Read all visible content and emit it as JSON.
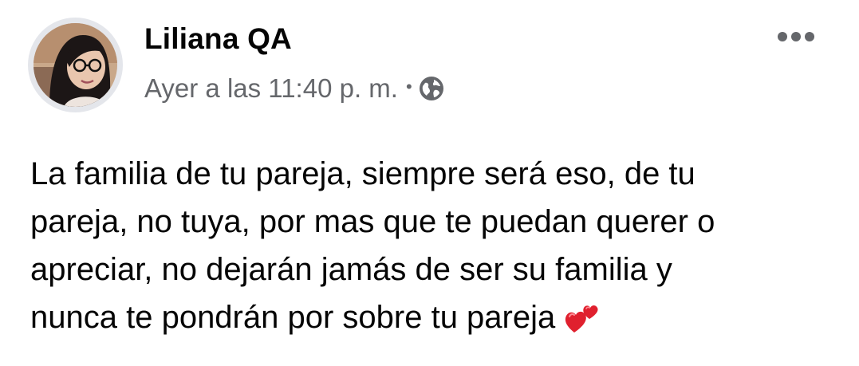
{
  "author": {
    "name": "Liliana QA"
  },
  "post": {
    "timestamp": "Ayer a las 11:40 p. m.",
    "separator": "•",
    "privacy_icon": "globe-icon",
    "text_lines": [
      "La familia de tu pareja, siempre será eso, de tu",
      "pareja, no tuya, por mas que te puedan querer o",
      "apreciar, no dejarán jamás de ser su familia y",
      "nunca te pondrán por sobre tu pareja"
    ],
    "emoji": "two-hearts-icon"
  },
  "actions": {
    "more_icon": "more-options-icon"
  },
  "colors": {
    "text_primary": "#050505",
    "text_secondary": "#65676b",
    "heart_red": "#e0202e"
  }
}
